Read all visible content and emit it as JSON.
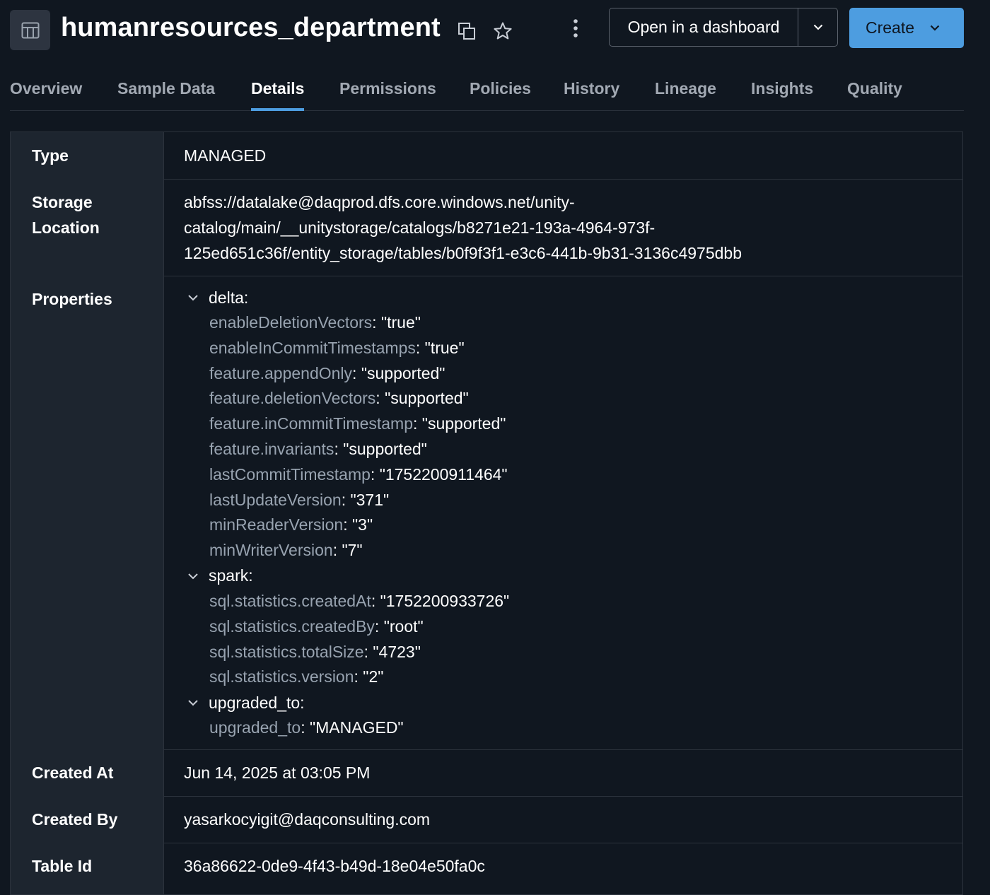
{
  "header": {
    "title": "humanresources_department",
    "open_dashboard_label": "Open in a dashboard",
    "create_label": "Create"
  },
  "tabs": [
    {
      "label": "Overview",
      "active": false
    },
    {
      "label": "Sample Data",
      "active": false
    },
    {
      "label": "Details",
      "active": true
    },
    {
      "label": "Permissions",
      "active": false
    },
    {
      "label": "Policies",
      "active": false
    },
    {
      "label": "History",
      "active": false
    },
    {
      "label": "Lineage",
      "active": false
    },
    {
      "label": "Insights",
      "active": false
    },
    {
      "label": "Quality",
      "active": false
    }
  ],
  "details": {
    "type_label": "Type",
    "type_value": "MANAGED",
    "storage_label_1": "Storage",
    "storage_label_2": "Location",
    "storage_value": "abfss://datalake@daqprod.dfs.core.windows.net/unity-catalog/main/__unitystorage/catalogs/b8271e21-193a-4964-973f-125ed651c36f/entity_storage/tables/b0f9f3f1-e3c6-441b-9b31-3136c4975dbb",
    "storage_lines": [
      "abfss://datalake@daqprod.dfs.core.windows.net/unity-",
      "catalog/main/__unitystorage/catalogs/b8271e21-193a-4964-973f-",
      "125ed651c36f/entity_storage/tables/b0f9f3f1-e3c6-441b-9b31-3136c4975dbb"
    ],
    "properties_label": "Properties",
    "properties": {
      "delta": {
        "name": "delta:",
        "items": [
          {
            "key": "enableDeletionVectors",
            "value": "\"true\""
          },
          {
            "key": "enableInCommitTimestamps",
            "value": "\"true\""
          },
          {
            "key": "feature.appendOnly",
            "value": "\"supported\""
          },
          {
            "key": "feature.deletionVectors",
            "value": "\"supported\""
          },
          {
            "key": "feature.inCommitTimestamp",
            "value": "\"supported\""
          },
          {
            "key": "feature.invariants",
            "value": "\"supported\""
          },
          {
            "key": "lastCommitTimestamp",
            "value": "\"1752200911464\""
          },
          {
            "key": "lastUpdateVersion",
            "value": "\"371\""
          },
          {
            "key": "minReaderVersion",
            "value": "\"3\""
          },
          {
            "key": "minWriterVersion",
            "value": "\"7\""
          }
        ]
      },
      "spark": {
        "name": "spark:",
        "items": [
          {
            "key": "sql.statistics.createdAt",
            "value": "\"1752200933726\""
          },
          {
            "key": "sql.statistics.createdBy",
            "value": "\"root\""
          },
          {
            "key": "sql.statistics.totalSize",
            "value": "\"4723\""
          },
          {
            "key": "sql.statistics.version",
            "value": "\"2\""
          }
        ]
      },
      "upgraded_to": {
        "name": "upgraded_to:",
        "items": [
          {
            "key": "upgraded_to",
            "value": "\"MANAGED\""
          }
        ]
      }
    },
    "created_at_label": "Created At",
    "created_at_value": "Jun 14, 2025 at 03:05 PM",
    "created_by_label": "Created By",
    "created_by_value": "yasarkocyigit@daqconsulting.com",
    "table_id_label": "Table Id",
    "table_id_value": "36a86622-0de9-4f43-b49d-18e04e50fa0c"
  },
  "colors": {
    "background": "#101720",
    "label_column": "#1d252f",
    "accent": "#4d9de0",
    "property_key": "#98a3b0"
  },
  "icons": [
    "table-icon",
    "copy-icon",
    "star-icon",
    "kebab-menu-icon",
    "chevron-down-icon"
  ]
}
